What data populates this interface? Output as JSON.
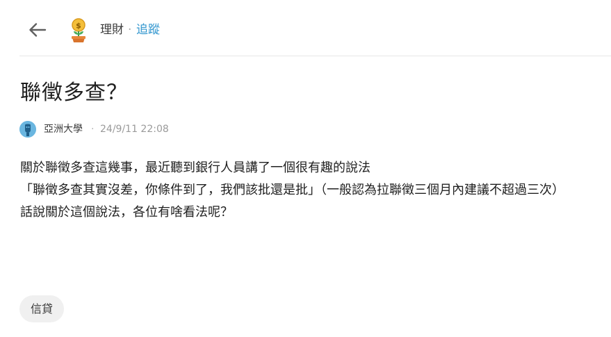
{
  "header": {
    "forum_name": "理財",
    "separator": "·",
    "follow_label": "追蹤",
    "back_icon": "arrow-left-icon",
    "forum_icon": "money-plant-icon"
  },
  "post": {
    "title": "聯徵多查？",
    "author": "亞洲大學",
    "meta_separator": "·",
    "timestamp": "24/9/11 22:08",
    "body_lines": [
      "關於聯徵多查這幾事，最近聽到銀行人員講了一個很有趣的說法",
      "「聯徵多查其實沒差，你條件到了，我們該批還是批」（一般認為拉聯徵三個月內建議不超過三次）",
      "話說關於這個說法，各位有啥看法呢？"
    ],
    "tags": [
      "信貸"
    ]
  },
  "colors": {
    "accent": "#3397cf",
    "text": "#1f1f1f",
    "muted": "#9a9a9a",
    "divider": "#e6e6e6",
    "chip_bg": "#f0f0f0",
    "avatar_bg": "#6ab6e0"
  }
}
